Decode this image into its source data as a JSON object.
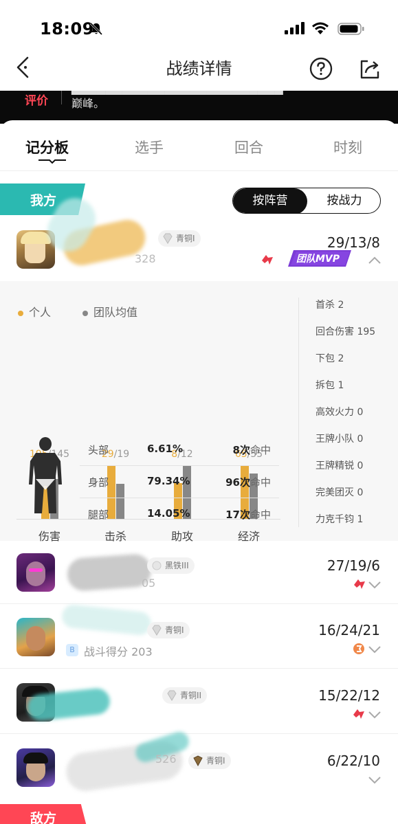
{
  "status": {
    "time": "18:09"
  },
  "nav": {
    "title": "战绩详情"
  },
  "banner": {
    "tag": "评价",
    "text": "巅峰。"
  },
  "tabs": [
    "记分板",
    "选手",
    "回合",
    "时刻"
  ],
  "team": {
    "label": "我方",
    "enemy_label": "敌方"
  },
  "sort": {
    "by_team": "按阵营",
    "by_power": "按战力"
  },
  "players": [
    {
      "rank": "青铜I",
      "kda": "29/13/8",
      "sub": "328",
      "mvp": "团队MVP"
    },
    {
      "rank": "黑铁III",
      "kda": "27/19/6",
      "sub": "05"
    },
    {
      "rank": "青铜I",
      "kda": "16/24/21",
      "sub": "战斗得分 203"
    },
    {
      "rank": "青铜II",
      "kda": "15/22/12",
      "sub": ""
    },
    {
      "rank": "青铜I",
      "kda": "6/22/10",
      "sub": "526"
    }
  ],
  "detail": {
    "legend": {
      "mine": "个人",
      "avg": "团队均值"
    },
    "chart_data": {
      "type": "bar",
      "categories": [
        "伤害",
        "击杀",
        "助攻",
        "经济"
      ],
      "series": [
        {
          "name": "个人",
          "values": [
            195,
            29,
            8,
            65
          ]
        },
        {
          "name": "团队均值",
          "values": [
            145,
            19,
            12,
            55
          ]
        }
      ]
    },
    "bar_value_labels": [
      {
        "mine": "195",
        "avg": "/145"
      },
      {
        "mine": "29",
        "avg": "/19"
      },
      {
        "mine": "8",
        "avg": "/12"
      },
      {
        "mine": "65",
        "avg": "/55"
      }
    ],
    "hits": [
      {
        "part": "头部",
        "pct": "6.61%",
        "count": "8",
        "unit": "次",
        "suffix": "命中"
      },
      {
        "part": "身部",
        "pct": "79.34%",
        "count": "96",
        "unit": "次",
        "suffix": "命中"
      },
      {
        "part": "腿部",
        "pct": "14.05%",
        "count": "17",
        "unit": "次",
        "suffix": "命中"
      }
    ],
    "stats": [
      "首杀 2",
      "回合伤害 195",
      "下包 2",
      "拆包 1",
      "高效火力 0",
      "王牌小队 0",
      "王牌精锐 0",
      "完美团灭 0",
      "力克千钧 1"
    ]
  },
  "colors": {
    "accent": "#2bb9b1",
    "mine_bar": "#e8ac3c",
    "avg_bar": "#878787",
    "mvp": "#7b3bd6",
    "enemy": "#ff4655"
  }
}
